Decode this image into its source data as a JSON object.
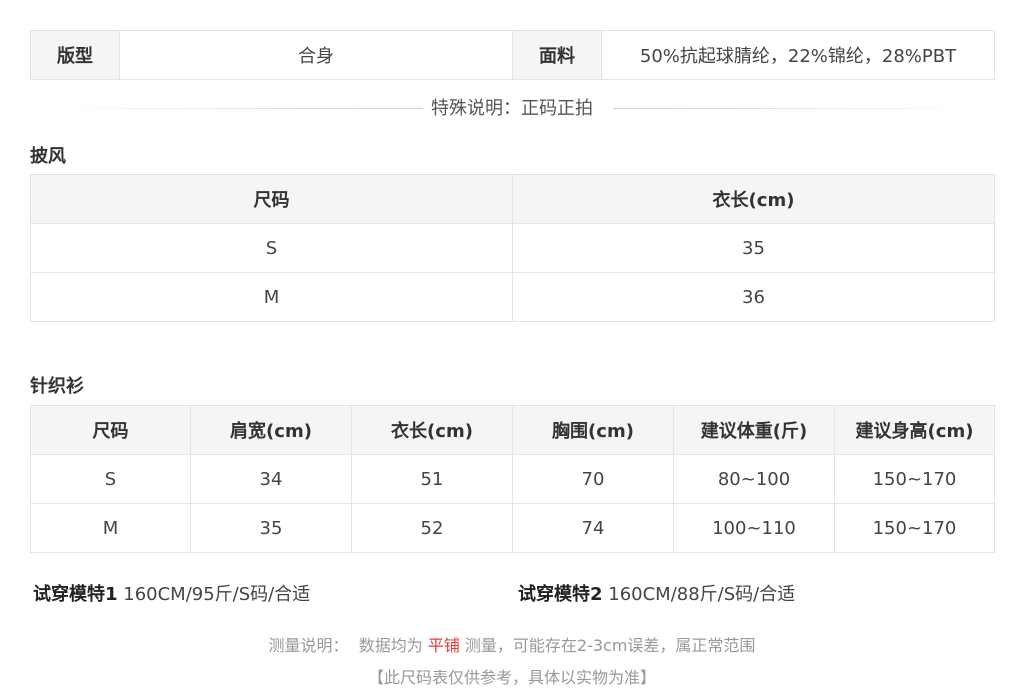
{
  "spec": {
    "fit_label": "版型",
    "fit_value": "合身",
    "fabric_label": "面料",
    "fabric_value": "50%抗起球腈纶，22%锦纶，28%PBT"
  },
  "note": "特殊说明：正码正拍",
  "cape": {
    "title": "披风",
    "headers": [
      "尺码",
      "衣长(cm)"
    ],
    "rows": [
      [
        "S",
        "35"
      ],
      [
        "M",
        "36"
      ]
    ]
  },
  "knit": {
    "title": "针织衫",
    "headers": [
      "尺码",
      "肩宽(cm)",
      "衣长(cm)",
      "胸围(cm)",
      "建议体重(斤)",
      "建议身高(cm)"
    ],
    "rows": [
      [
        "S",
        "34",
        "51",
        "70",
        "80~100",
        "150~170"
      ],
      [
        "M",
        "35",
        "52",
        "74",
        "100~110",
        "150~170"
      ]
    ]
  },
  "models": [
    {
      "label": "试穿模特1",
      "value": " 160CM/95斤/S码/合适"
    },
    {
      "label": "试穿模特2",
      "value": " 160CM/88斤/S码/合适"
    }
  ],
  "measure": {
    "prefix": "测量说明：  数据均为 ",
    "highlight": "平铺",
    "suffix": " 测量，可能存在2-3cm误差，属正常范围"
  },
  "disclaimer": "【此尺码表仅供参考，具体以实物为准】",
  "colors": {
    "highlight": "#e53935",
    "header_bg": "#f5f5f5",
    "border": "#e4e4e4"
  }
}
